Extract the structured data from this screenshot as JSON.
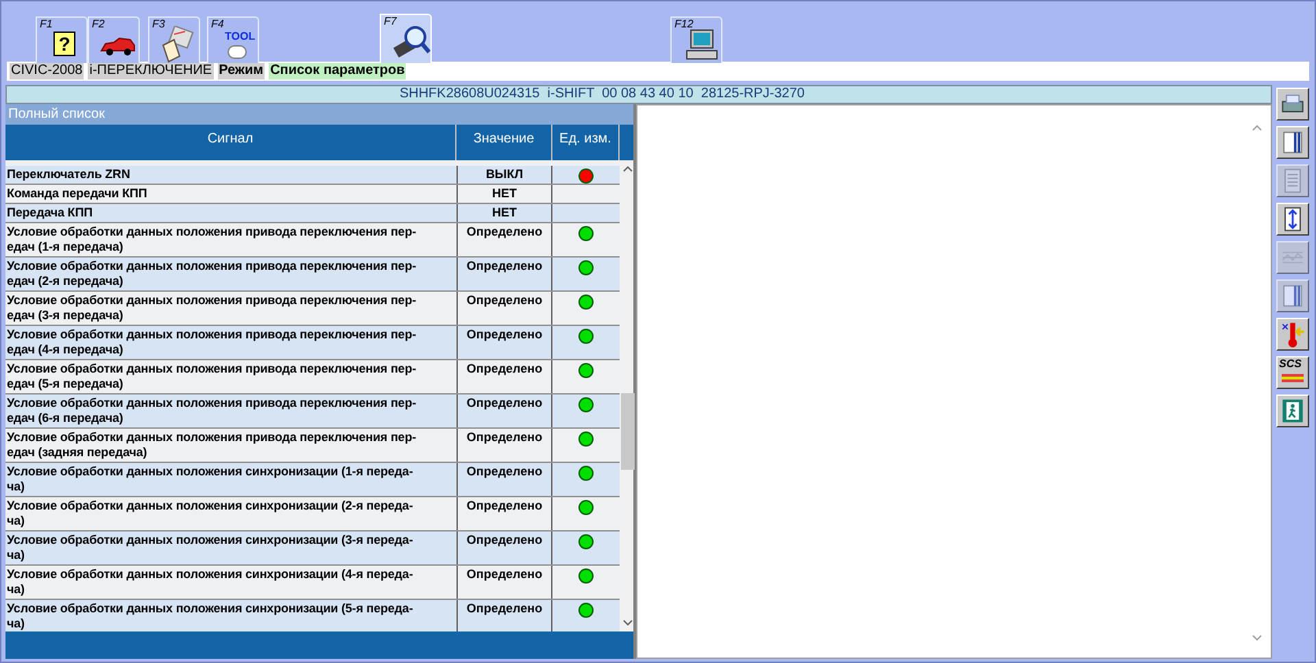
{
  "function_keys": [
    {
      "label": "F1",
      "selected": false
    },
    {
      "label": "F2",
      "selected": false
    },
    {
      "label": "F3",
      "selected": false
    },
    {
      "label": "F4",
      "selected": false
    },
    {
      "label": "F7",
      "selected": true
    },
    {
      "label": "F12",
      "selected": false
    }
  ],
  "tool_label": "TOOL",
  "help_glyph": "?",
  "breadcrumb": [
    "CIVIC-2008",
    "i-ПЕРЕКЛЮЧЕНИЕ",
    "Режим",
    "Список параметров"
  ],
  "info_bar": "SHHFK28608U024315  i-SHIFT  00 08 43 40 10  28125-RPJ-3270",
  "list_title": "Полный список",
  "columns": [
    "Сигнал",
    "Значение",
    "Ед. изм."
  ],
  "rows": [
    {
      "signal": "Переключатель ZRN",
      "value": "ВЫКЛ",
      "color": "#ff0000"
    },
    {
      "signal": "Команда передачи КПП",
      "value": "НЕТ"
    },
    {
      "signal": "Передача КПП",
      "value": "НЕТ"
    },
    {
      "signal": "Условие обработки данных положения привода переключения пер-\nедач (1-я передача)",
      "value": "Определено",
      "color": "#00e000"
    },
    {
      "signal": "Условие обработки данных положения привода переключения пер-\nедач (2-я передача)",
      "value": "Определено",
      "color": "#00e000"
    },
    {
      "signal": "Условие обработки данных положения привода переключения пер-\nедач (3-я передача)",
      "value": "Определено",
      "color": "#00e000"
    },
    {
      "signal": "Условие обработки данных положения привода переключения пер-\nедач (4-я передача)",
      "value": "Определено",
      "color": "#00e000"
    },
    {
      "signal": "Условие обработки данных положения привода переключения пер-\nедач (5-я передача)",
      "value": "Определено",
      "color": "#00e000"
    },
    {
      "signal": "Условие обработки данных положения привода переключения пер-\nедач (6-я передача)",
      "value": "Определено",
      "color": "#00e000"
    },
    {
      "signal": "Условие обработки данных положения привода переключения пер-\nедач (задняя передача)",
      "value": "Определено",
      "color": "#00e000"
    },
    {
      "signal": "Условие обработки данных положения синхронизации (1-я переда-\nча)",
      "value": "Определено",
      "color": "#00e000"
    },
    {
      "signal": "Условие обработки данных положения синхронизации (2-я переда-\nча)",
      "value": "Определено",
      "color": "#00e000"
    },
    {
      "signal": "Условие обработки данных положения синхронизации (3-я переда-\nча)",
      "value": "Определено",
      "color": "#00e000"
    },
    {
      "signal": "Условие обработки данных положения синхронизации (4-я переда-\nча)",
      "value": "Определено",
      "color": "#00e000"
    },
    {
      "signal": "Условие обработки данных положения синхронизации (5-я переда-\nча)",
      "value": "Определено",
      "color": "#00e000"
    }
  ],
  "side_tools": [
    {
      "kind": "print",
      "disabled": false
    },
    {
      "kind": "settings",
      "disabled": false
    },
    {
      "kind": "list",
      "disabled": true
    },
    {
      "kind": "updown",
      "disabled": false
    },
    {
      "kind": "graph",
      "disabled": true
    },
    {
      "kind": "settings",
      "disabled": true
    },
    {
      "kind": "temp",
      "disabled": false
    },
    {
      "kind": "scs",
      "label": "SCS",
      "disabled": false
    },
    {
      "kind": "exit",
      "disabled": false
    }
  ]
}
